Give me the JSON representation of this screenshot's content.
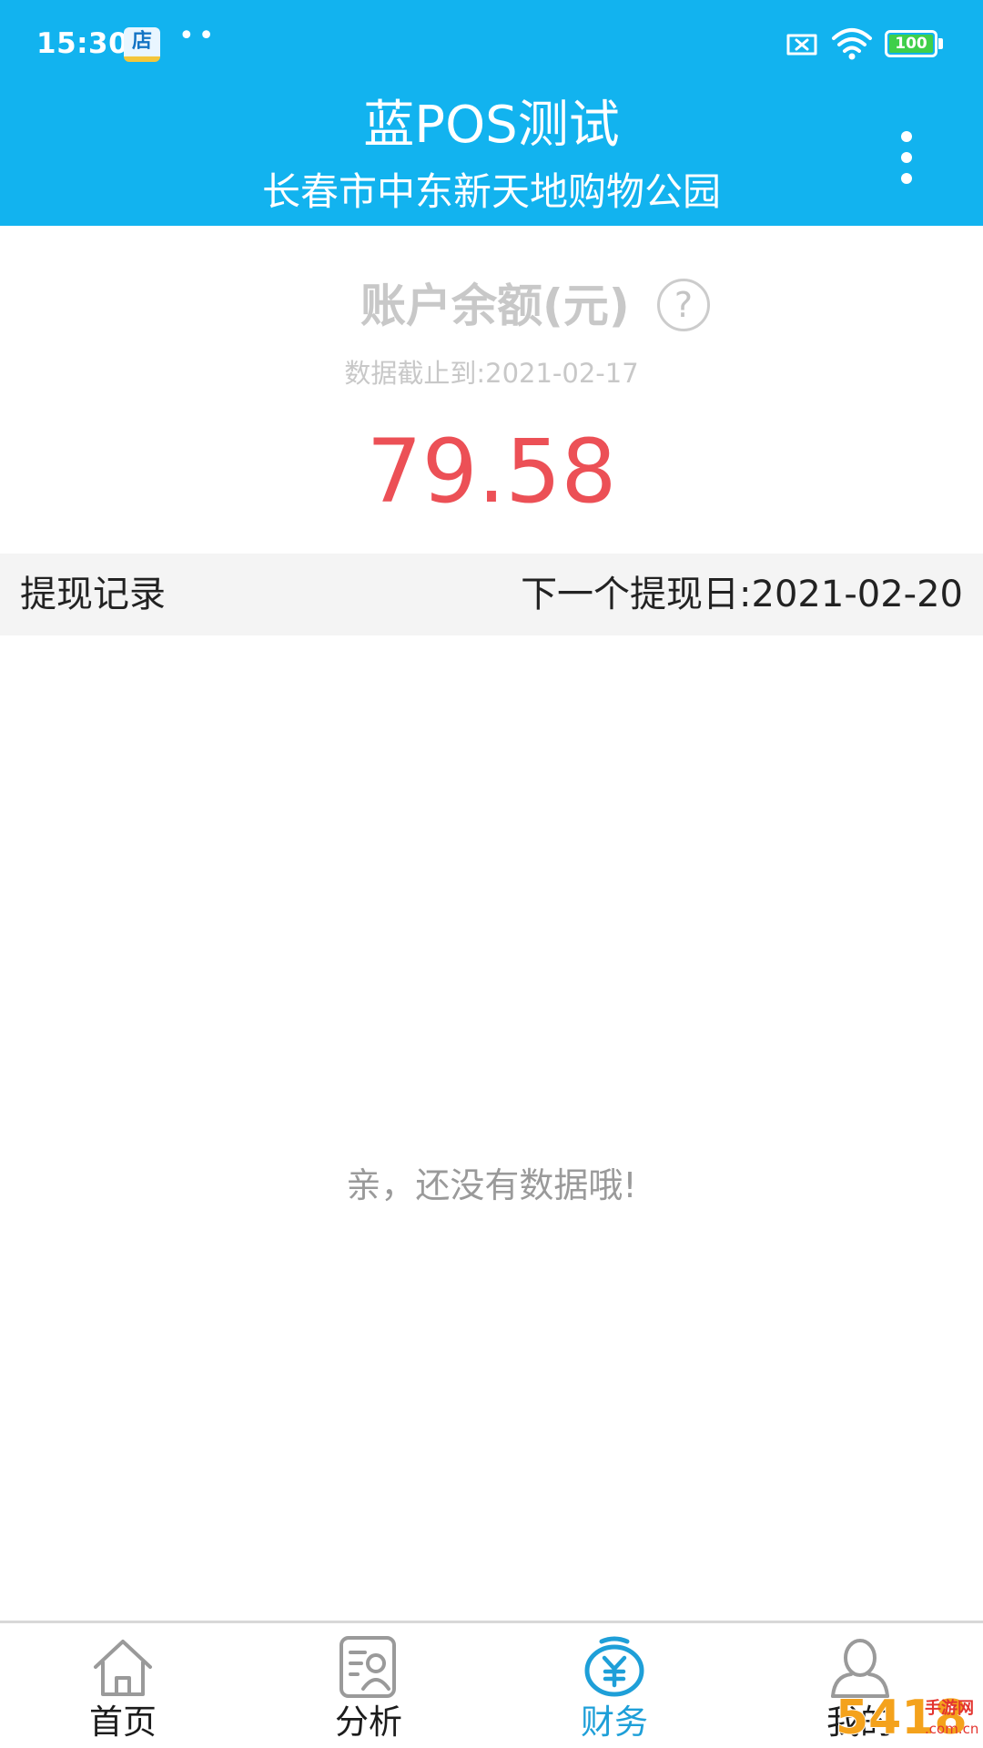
{
  "status_bar": {
    "time": "15:30",
    "app_icon_text": "店",
    "dots": "••",
    "battery_level": "100",
    "icons": [
      "sim-off-icon",
      "wifi-icon",
      "battery-icon"
    ]
  },
  "header": {
    "title": "蓝POS测试",
    "subtitle": "长春市中东新天地购物公园",
    "more_icon": "more-vertical-icon"
  },
  "balance": {
    "label": "账户余额(元)",
    "help_icon_text": "?",
    "data_date": "数据截止到:2021-02-17",
    "amount": "79.58"
  },
  "withdraw": {
    "title": "提现记录",
    "next_date": "下一个提现日:2021-02-20"
  },
  "empty_state": {
    "message": "亲，还没有数据哦!"
  },
  "bottom_nav": {
    "items": [
      {
        "label": "首页",
        "icon": "home-icon",
        "active": false
      },
      {
        "label": "分析",
        "icon": "analysis-icon",
        "active": false
      },
      {
        "label": "财务",
        "icon": "finance-yen-icon",
        "active": true
      },
      {
        "label": "我的",
        "icon": "user-icon",
        "active": false
      }
    ]
  },
  "colors": {
    "header_bg": "#12b3ef",
    "amount": "#ec5056",
    "active_tab": "#1e9fd8",
    "muted_text": "#c8c8c8",
    "empty_text": "#9a9a9a",
    "bar_bg": "#f4f4f4"
  },
  "watermark": {
    "text_main": "5418",
    "text_side": "手游网",
    "text_domain": ".com.cn"
  }
}
